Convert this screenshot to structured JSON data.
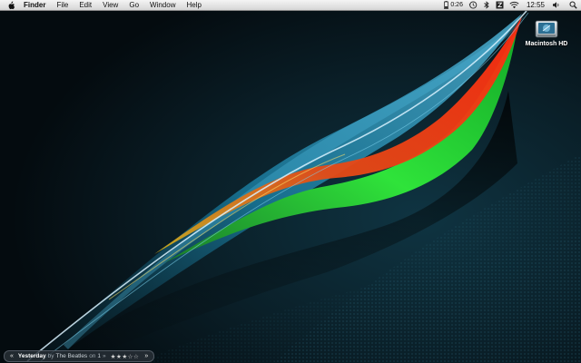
{
  "menubar": {
    "apple_icon": "apple-logo-icon",
    "app_name": "Finder",
    "menus": [
      "File",
      "Edit",
      "View",
      "Go",
      "Window",
      "Help"
    ],
    "status": {
      "battery_time": "0:26",
      "icons": [
        "battery-icon",
        "time-machine-icon",
        "bluetooth-icon",
        "script-icon",
        "wifi-icon",
        "volume-icon",
        "spotlight-icon"
      ],
      "clock": "12:55"
    }
  },
  "desktop": {
    "icons": [
      {
        "label": "Macintosh HD",
        "icon": "hard-drive-icon"
      }
    ]
  },
  "now_playing": {
    "prev_label": "«",
    "title": "Yesterday",
    "by_label": "by",
    "artist": "The Beatles",
    "on_label": "on",
    "album": "1",
    "separator": "»",
    "rating_text": "★★★☆☆",
    "next_label": "»",
    "rating": 3,
    "rating_max": 5
  }
}
